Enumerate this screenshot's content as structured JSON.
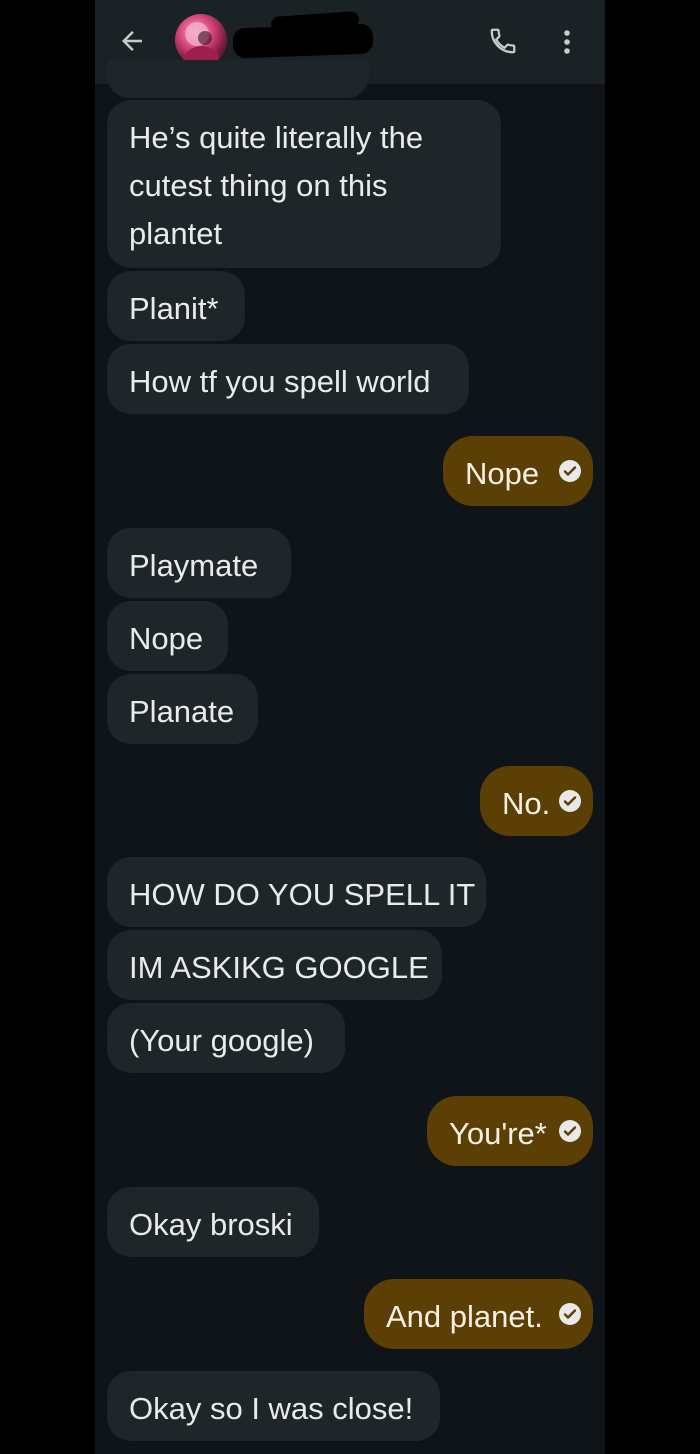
{
  "header": {
    "back_icon": "arrow-left-icon",
    "call_icon": "phone-icon",
    "more_icon": "more-vert-icon"
  },
  "colors": {
    "incoming_bubble": "#1f262a",
    "outgoing_bubble": "#5b3f04",
    "background": "#0f1418"
  },
  "messages": [
    {
      "dir": "in",
      "lines": [
        "He’s quite literally the",
        "cutest thing on this",
        "plantet"
      ]
    },
    {
      "dir": "in",
      "text": "Planit*"
    },
    {
      "dir": "in",
      "text": "How tf you spell world"
    },
    {
      "dir": "out",
      "text": "Nope",
      "status_icon": "read-check-icon"
    },
    {
      "dir": "in",
      "text": "Playmate"
    },
    {
      "dir": "in",
      "text": "Nope"
    },
    {
      "dir": "in",
      "text": "Planate"
    },
    {
      "dir": "out",
      "text": "No.",
      "status_icon": "read-check-icon"
    },
    {
      "dir": "in",
      "text": "HOW DO YOU SPELL IT"
    },
    {
      "dir": "in",
      "text": "IM ASKIKG GOOGLE"
    },
    {
      "dir": "in",
      "text": "(Your google)"
    },
    {
      "dir": "out",
      "text": "You're*",
      "status_icon": "read-check-icon"
    },
    {
      "dir": "in",
      "text": "Okay broski"
    },
    {
      "dir": "out",
      "text": "And planet.",
      "status_icon": "read-check-icon"
    },
    {
      "dir": "in",
      "text": "Okay so I was close!"
    }
  ]
}
